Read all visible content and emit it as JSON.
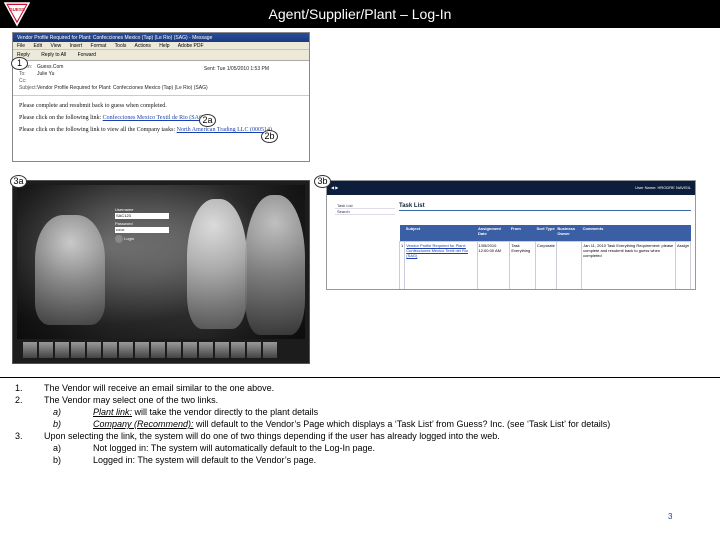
{
  "slide": {
    "title": "Agent/Supplier/Plant – Log-In",
    "page_number": "3",
    "logo_icon": "guess-triangle-logo",
    "logo_text": "GUESS"
  },
  "markers": {
    "m1": "1",
    "m2a": "2a",
    "m2b": "2b",
    "m3a": "3a",
    "m3b": "3b"
  },
  "email": {
    "window_title": "Vendor Profile Required for Plant: Confecciones Mexico (Tap) (Le Rio) (SAG) - Message",
    "menu": [
      "File",
      "Edit",
      "View",
      "Insert",
      "Format",
      "Tools",
      "Actions",
      "Help",
      "Adobe PDF"
    ],
    "toolbar": [
      "Reply",
      "Reply to All",
      "Forward"
    ],
    "from_label": "From:",
    "from_value": "Guess.Com",
    "to_label": "To:",
    "to_value": "Julie Yu",
    "cc_label": "Cc:",
    "cc_value": "",
    "subject_label": "Subject:",
    "subject_value": "Vendor Profile Required for Plant: Confecciones Mexico (Tap) (Le Rio) (SAG)",
    "sent_label": "Sent:",
    "sent_value": "Tue 1/05/2010 1:53 PM",
    "line1": "Please complete and resubmit back to guess when completed.",
    "line2_prefix": "Please click on the following link: ",
    "line2_link": "Confecciones Mexico Textil de Rio (SAG)",
    "line3_prefix": "Please click on the following link to view all the Company tasks: ",
    "line3_link": "North American Trading LLC (000514)"
  },
  "login": {
    "username_label": "Username",
    "username_value": "SAC123",
    "password_label": "Password",
    "password_value": "••••••",
    "login_label": "Login"
  },
  "tasks": {
    "user": "User Name: HRODRE  NAVISIL",
    "nav": [
      "Task List",
      "Search"
    ],
    "title": "Task List",
    "page_select": "Page",
    "columns": [
      "",
      "Subject",
      "Assignment Date",
      "From",
      "Sort Type",
      "Business Owner",
      "Comments",
      ""
    ],
    "row": [
      "1",
      "Vendor Profile Required for Plant: Confecciones Mexico Textil del Rio (SAG)",
      "1/05/2010 12:00:00 AM",
      "Task Everything",
      "Corporate",
      "",
      "Jan 11, 2010 Task Everything Requirement: please complete and resubmit back to guess when completed",
      "Assign"
    ]
  },
  "instructions": {
    "i1_num": "1.",
    "i1": "The Vendor will receive an email similar to the one above.",
    "i2_num": "2.",
    "i2": "The Vendor may select one of the two links.",
    "i2a_num": "a)",
    "i2a_link": "Plant link:",
    "i2a_text": "  will take the vendor directly to the plant details",
    "i2b_num": "b)",
    "i2b_link": "Company (Recommend):",
    "i2b_text": "  will default to the Vendor’s Page which displays a ‘Task List’ from Guess? Inc. (see ‘Task List’ for details)",
    "i3_num": "3.",
    "i3": "Upon selecting the link, the system will do one of two things depending if the user has already logged into the web.",
    "i3a_num": "a)",
    "i3a": "Not logged in:  The system will automatically default to the Log-In page.",
    "i3b_num": "b)",
    "i3b": "Logged in:  The system will default to the Vendor’s page."
  }
}
